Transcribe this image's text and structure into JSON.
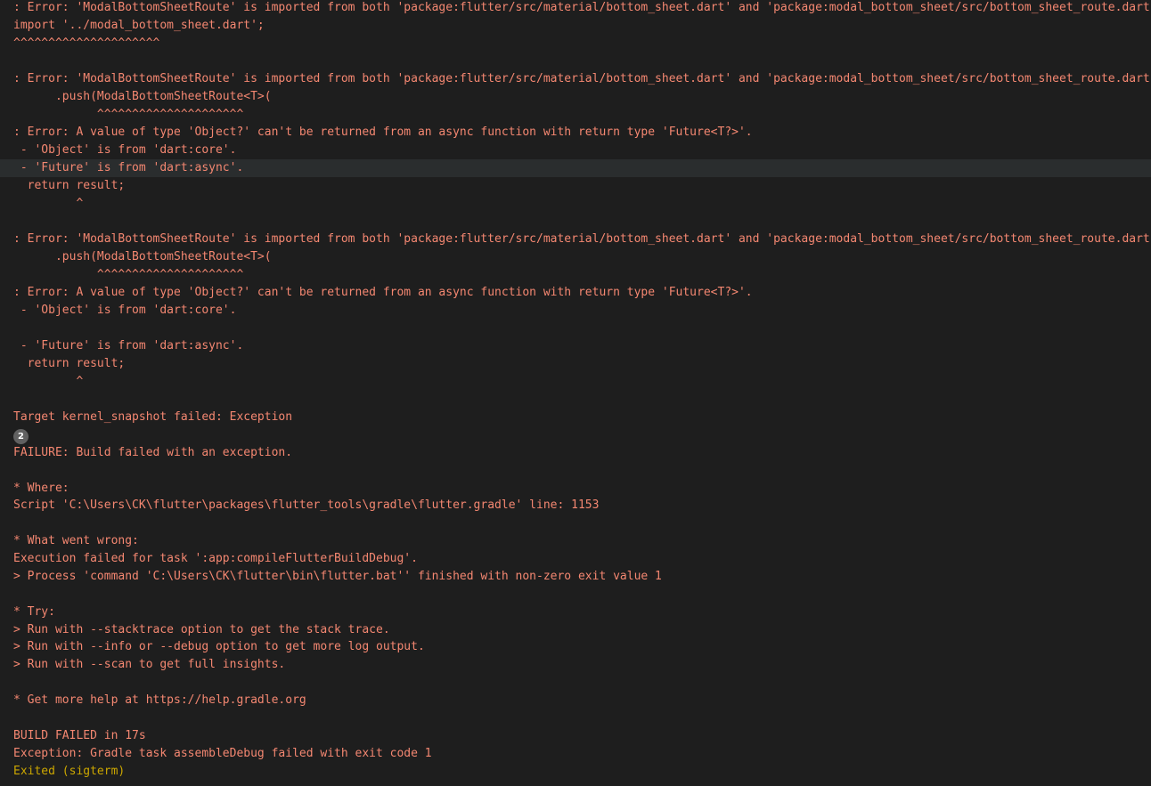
{
  "colors": {
    "background": "#1e1e1e",
    "error_text": "#f48771",
    "exit_text": "#cca700",
    "highlight_row": "#2a2d2e",
    "badge": "#616161"
  },
  "badge": {
    "count": "2"
  },
  "lines": [
    ": Error: 'ModalBottomSheetRoute' is imported from both 'package:flutter/src/material/bottom_sheet.dart' and 'package:modal_bottom_sheet/src/bottom_sheet_route.dart'.",
    "import '../modal_bottom_sheet.dart';",
    "^^^^^^^^^^^^^^^^^^^^^",
    ": Error: 'ModalBottomSheetRoute' is imported from both 'package:flutter/src/material/bottom_sheet.dart' and 'package:modal_bottom_sheet/src/bottom_sheet_route.dart'.",
    "      .push(ModalBottomSheetRoute<T>(",
    "            ^^^^^^^^^^^^^^^^^^^^^",
    ": Error: A value of type 'Object?' can't be returned from an async function with return type 'Future<T?>'.",
    " - 'Object' is from 'dart:core'.",
    " - 'Future' is from 'dart:async'.",
    "  return result;",
    "         ^",
    ": Error: 'ModalBottomSheetRoute' is imported from both 'package:flutter/src/material/bottom_sheet.dart' and 'package:modal_bottom_sheet/src/bottom_sheet_route.dart'.",
    "      .push(ModalBottomSheetRoute<T>(",
    "            ^^^^^^^^^^^^^^^^^^^^^",
    ": Error: A value of type 'Object?' can't be returned from an async function with return type 'Future<T?>'.",
    " - 'Object' is from 'dart:core'.",
    " - 'Future' is from 'dart:async'.",
    "  return result;",
    "         ^",
    "Target kernel_snapshot failed: Exception",
    "FAILURE: Build failed with an exception.",
    "* Where:",
    "Script 'C:\\Users\\CK\\flutter\\packages\\flutter_tools\\gradle\\flutter.gradle' line: 1153",
    "* What went wrong:",
    "Execution failed for task ':app:compileFlutterBuildDebug'.",
    "> Process 'command 'C:\\Users\\CK\\flutter\\bin\\flutter.bat'' finished with non-zero exit value 1",
    "* Try:",
    "> Run with --stacktrace option to get the stack trace.",
    "> Run with --info or --debug option to get more log output.",
    "> Run with --scan to get full insights.",
    "* Get more help at https://help.gradle.org",
    "BUILD FAILED in 17s",
    "Exception: Gradle task assembleDebug failed with exit code 1",
    "Exited (sigterm)"
  ]
}
